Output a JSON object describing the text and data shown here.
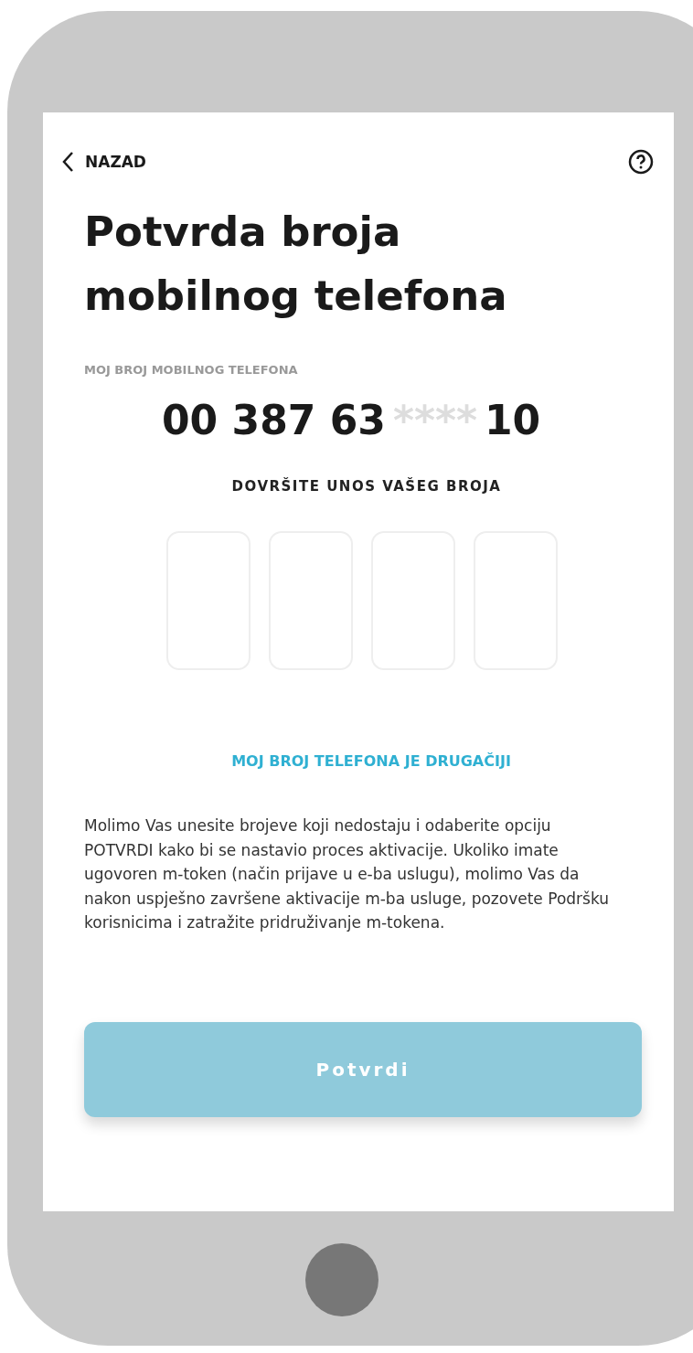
{
  "header": {
    "back_label": "NAZAD"
  },
  "title": "Potvrda broja mobilnog telefona",
  "phone": {
    "label": "MOJ BROJ MOBILNOG TELEFONA",
    "prefix": "00 387 63",
    "masked": "****",
    "suffix": "10"
  },
  "entry": {
    "label": "DOVRŠITE UNOS VAŠEG BROJA",
    "digits": [
      {
        "filled": false
      },
      {
        "filled": false
      },
      {
        "filled": false
      },
      {
        "filled": false
      }
    ]
  },
  "link": "MOJ BROJ TELEFONA JE DRUGAČIJI",
  "info": "Molimo Vas unesite brojeve koji nedostaju i odaberite opciju POTVRDI kako bi se nastavio proces aktivacije. Ukoliko imate ugovoren m-token (način prijave u e-ba uslugu), molimo Vas da nakon uspješno završene aktivacije m-ba usluge, pozovete Podršku korisnicima i zatražite pridruživanje m-tokena.",
  "confirm_button": {
    "label": "Potvrdi",
    "disabled": true
  }
}
